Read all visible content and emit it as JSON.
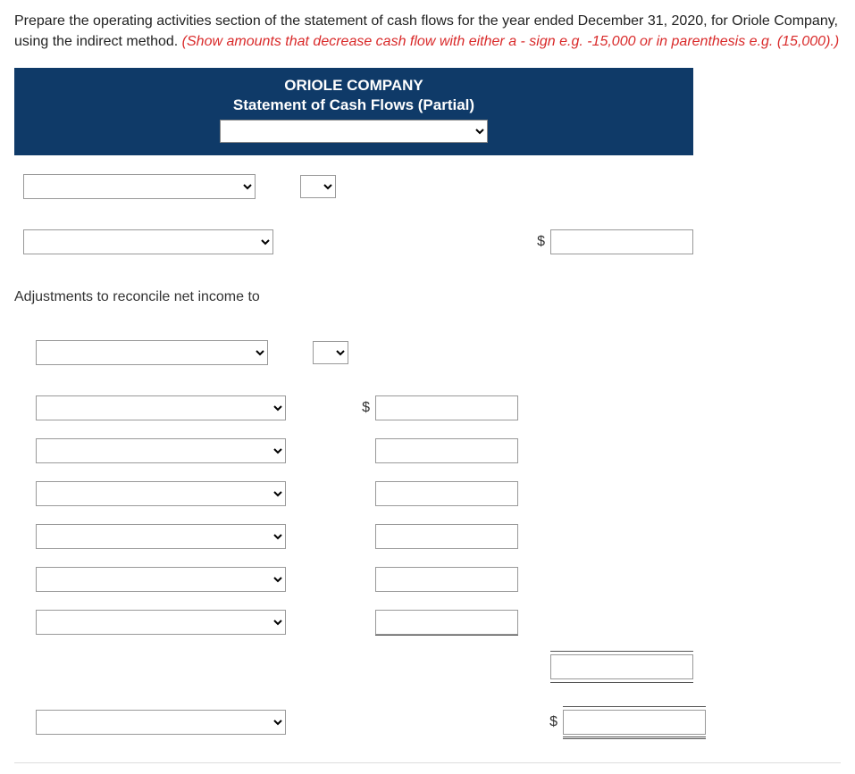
{
  "instructions": {
    "part1": "Prepare the operating activities section of the statement of cash flows for the year ended December 31, 2020, for Oriole Company, using the indirect method. ",
    "part2": "(Show amounts that decrease cash flow with either a - sign e.g. -15,000 or in parenthesis e.g. (15,000).)"
  },
  "banner": {
    "company": "ORIOLE COMPANY",
    "subtitle": "Statement of Cash Flows (Partial)",
    "period_value": ""
  },
  "section_label": "Adjustments to reconcile net income to",
  "currency": "$",
  "rows": {
    "r1": {
      "label": "",
      "suffix": ""
    },
    "r2": {
      "label": "",
      "amt2": ""
    },
    "r3": {
      "label": "",
      "suffix": ""
    },
    "r4": {
      "label": "",
      "amt1": ""
    },
    "r5": {
      "label": "",
      "amt1": ""
    },
    "r6": {
      "label": "",
      "amt1": ""
    },
    "r7": {
      "label": "",
      "amt1": ""
    },
    "r8": {
      "label": "",
      "amt1": ""
    },
    "r9": {
      "label": "",
      "amt1": ""
    },
    "subtotal": "",
    "r10": {
      "label": "",
      "amt2": ""
    }
  }
}
